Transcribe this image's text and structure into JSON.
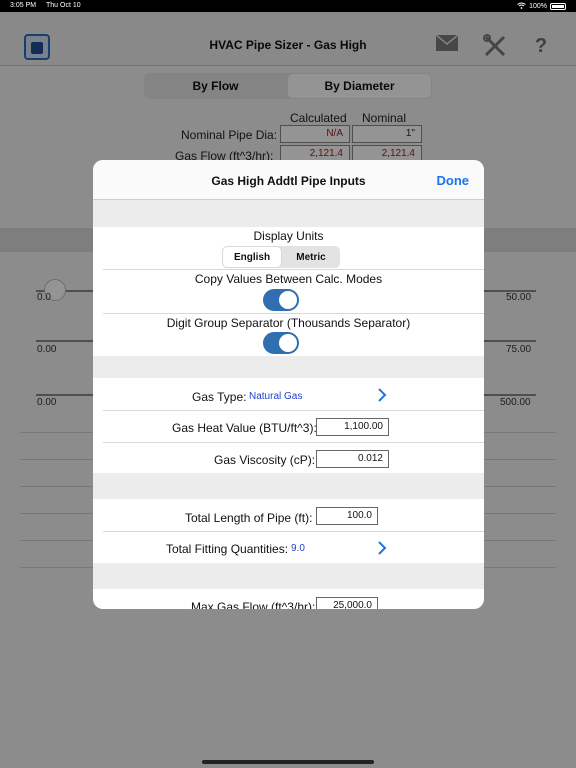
{
  "status": {
    "time": "3:05 PM",
    "date": "Thu Oct 10",
    "battery": "100%"
  },
  "nav": {
    "title": "HVAC Pipe Sizer - Gas High",
    "icons": [
      "app-icon",
      "mail-icon",
      "tools-icon",
      "help-icon"
    ]
  },
  "mode_tabs": [
    {
      "label": "By Flow",
      "selected": false
    },
    {
      "label": "By Diameter",
      "selected": true
    }
  ],
  "background": {
    "calculated_header": "Calculated",
    "nominal_header": "Nominal",
    "rows": [
      {
        "label": "Nominal Pipe Dia:",
        "calculated": "N/A",
        "nominal": "1\""
      },
      {
        "label": "Gas Flow (ft^3/hr):",
        "calculated": "2,121.4",
        "nominal": "2,121.4"
      }
    ],
    "sliders": [
      {
        "min": "0.0",
        "max": "50.00"
      },
      {
        "min": "0.00",
        "max": "75.00"
      },
      {
        "min": "0.00",
        "max": "500.00"
      }
    ]
  },
  "modal": {
    "title": "Gas High Addtl Pipe Inputs",
    "done_label": "Done",
    "display_units_label": "Display Units",
    "units_options": [
      {
        "label": "English",
        "selected": true
      },
      {
        "label": "Metric",
        "selected": false
      }
    ],
    "copy_values_label": "Copy Values Between Calc. Modes",
    "copy_values_on": true,
    "digit_sep_label": "Digit Group Separator (Thousands Separator)",
    "digit_sep_on": true,
    "gas_type_label": "Gas Type:",
    "gas_type_value": "Natural Gas",
    "heat_value_label": "Gas Heat Value (BTU/ft^3):",
    "heat_value": "1,100.00",
    "viscosity_label": "Gas Viscosity (cP):",
    "viscosity_value": "0.012",
    "total_length_label": "Total Length of Pipe (ft):",
    "total_length_value": "100.0",
    "fittings_label": "Total Fitting Quantities:",
    "fittings_value": "9.0",
    "max_flow_label": "Max Gas Flow (ft^3/hr):",
    "max_flow_value": "25,000.0"
  },
  "colors": {
    "accent": "#1a73e8",
    "toggle_on": "#2f6fb0",
    "value_blue": "#1f3fd1",
    "calc_red": "#9a2020"
  }
}
